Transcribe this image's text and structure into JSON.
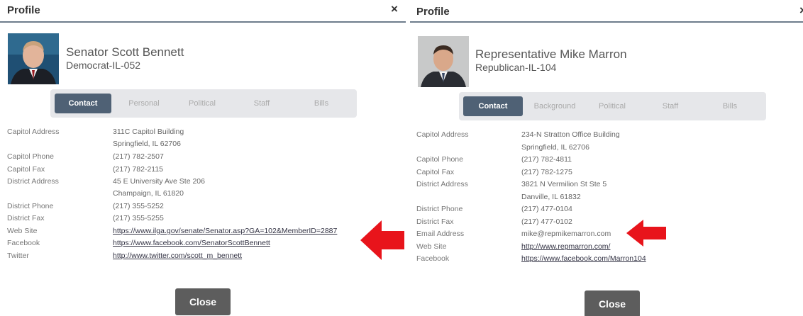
{
  "left": {
    "header": {
      "title": "Profile",
      "close_glyph": "×"
    },
    "person": {
      "name": "Senator Scott Bennett",
      "party": "Democrat-IL-052"
    },
    "tabs": [
      "Contact",
      "Personal",
      "Political",
      "Staff",
      "Bills"
    ],
    "fields": [
      {
        "label": "Capitol Address",
        "value": "311C Capitol Building"
      },
      {
        "label": "",
        "value": "Springfield, IL 62706"
      },
      {
        "label": "Capitol Phone",
        "value": "(217) 782-2507"
      },
      {
        "label": "Capitol Fax",
        "value": "(217) 782-2115"
      },
      {
        "label": "District Address",
        "value": "45 E University Ave Ste 206"
      },
      {
        "label": "",
        "value": "Champaign, IL 61820"
      },
      {
        "label": "District Phone",
        "value": "(217) 355-5252"
      },
      {
        "label": "District Fax",
        "value": "(217) 355-5255"
      },
      {
        "label": "Web Site",
        "value": "https://www.ilga.gov/senate/Senator.asp?GA=102&MemberID=2887"
      },
      {
        "label": "Facebook",
        "value": "https://www.facebook.com/SenatorScottBennett"
      },
      {
        "label": "Twitter",
        "value": "http://www.twitter.com/scott_m_bennett"
      }
    ],
    "close_label": "Close"
  },
  "right": {
    "header": {
      "title": "Profile",
      "close_glyph": "×"
    },
    "person": {
      "name": "Representative Mike Marron",
      "party": "Republican-IL-104"
    },
    "tabs": [
      "Contact",
      "Background",
      "Political",
      "Staff",
      "Bills"
    ],
    "fields": [
      {
        "label": "Capitol Address",
        "value": "234-N Stratton Office Building"
      },
      {
        "label": "",
        "value": "Springfield, IL 62706"
      },
      {
        "label": "Capitol Phone",
        "value": "(217) 782-4811"
      },
      {
        "label": "Capitol Fax",
        "value": "(217) 782-1275"
      },
      {
        "label": "District Address",
        "value": "3821 N Vermilion St Ste 5"
      },
      {
        "label": "",
        "value": "Danville, IL 61832"
      },
      {
        "label": "District Phone",
        "value": "(217) 477-0104"
      },
      {
        "label": "District Fax",
        "value": "(217) 477-0102"
      },
      {
        "label": "Email Address",
        "value": "mike@repmikemarron.com"
      },
      {
        "label": "Web Site",
        "value": "http://www.repmarron.com/"
      },
      {
        "label": "Facebook",
        "value": "https://www.facebook.com/Marron104"
      }
    ],
    "close_label": "Close"
  },
  "colors": {
    "tab_active": "#4f6175",
    "header_rule": "#6e7d8c",
    "arrow": "#e8141b",
    "close_button": "#5d5d5d"
  }
}
